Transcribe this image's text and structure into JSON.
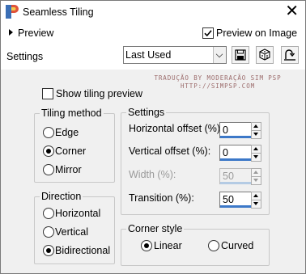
{
  "window": {
    "title": "Seamless Tiling",
    "close_glyph": "✕"
  },
  "preview": {
    "label": "Preview",
    "preview_on_image_label": "Preview on Image",
    "preview_on_image_checked": true
  },
  "settings": {
    "label": "Settings",
    "preset_value": "Last Used"
  },
  "watermark": {
    "line1": "TRADUÇÃO BY MODERAÇÃO SIM PSP",
    "line2": "HTTP://SIMPSP.COM"
  },
  "show_tiling_preview": {
    "label": "Show tiling preview",
    "checked": false
  },
  "tiling_method": {
    "title": "Tiling method",
    "options": [
      "Edge",
      "Corner",
      "Mirror"
    ],
    "selected": "Corner"
  },
  "direction": {
    "title": "Direction",
    "options": [
      "Horizontal",
      "Vertical",
      "Bidirectional"
    ],
    "selected": "Bidirectional"
  },
  "settings_group": {
    "title": "Settings",
    "horizontal_offset": {
      "label": "Horizontal offset (%):",
      "value": "0"
    },
    "vertical_offset": {
      "label": "Vertical offset (%):",
      "value": "0"
    },
    "width": {
      "label": "Width (%):",
      "value": "50",
      "enabled": false
    },
    "transition": {
      "label": "Transition (%):",
      "value": "50"
    }
  },
  "corner_style": {
    "title": "Corner style",
    "options": [
      "Linear",
      "Curved"
    ],
    "selected": "Linear"
  },
  "icons": {
    "app": "paintshop-pro-icon",
    "save_preset": "save-icon",
    "randomize": "dice-icon",
    "reset": "reset-icon"
  },
  "colors": {
    "accent": "#3c78c8",
    "watermark": "#9b6b6b"
  }
}
